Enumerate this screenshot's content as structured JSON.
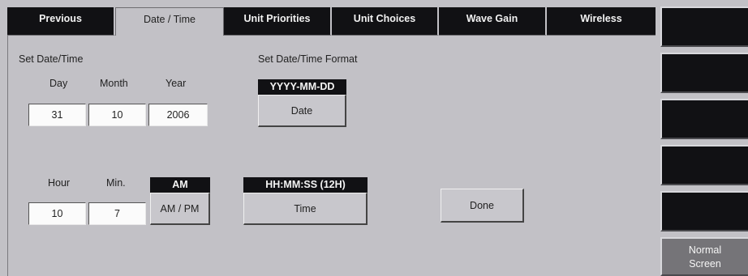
{
  "tabs": [
    {
      "label": "Previous"
    },
    {
      "label": "Date / Time"
    },
    {
      "label": "Unit Priorities"
    },
    {
      "label": "Unit Choices"
    },
    {
      "label": "Wave Gain"
    },
    {
      "label": "Wireless"
    }
  ],
  "active_tab": "Date / Time",
  "date_section": {
    "title": "Set Date/Time",
    "day_label": "Day",
    "month_label": "Month",
    "year_label": "Year",
    "day_value": "31",
    "month_value": "10",
    "year_value": "2006"
  },
  "format_section": {
    "title": "Set Date/Time Format",
    "date_format": "YYYY-MM-DD",
    "date_button": "Date",
    "time_format": "HH:MM:SS (12H)",
    "time_button": "Time"
  },
  "time_section": {
    "hour_label": "Hour",
    "min_label": "Min.",
    "hour_value": "10",
    "min_value": "7",
    "ampm_value": "AM",
    "ampm_button": "AM / PM"
  },
  "done_button": "Done",
  "sidebar": {
    "normal_line1": "Normal",
    "normal_line2": "Screen"
  },
  "colors": {
    "background": "#c2c1c6",
    "tab_dark": "#111114",
    "active_key": "#757478"
  }
}
